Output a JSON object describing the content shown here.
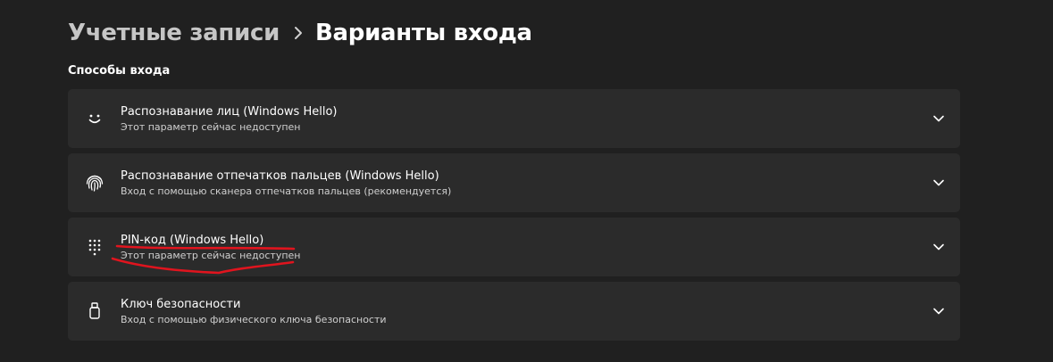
{
  "breadcrumb": {
    "parent": "Учетные записи",
    "current": "Варианты входа"
  },
  "section_title": "Способы входа",
  "options": [
    {
      "icon": "face-icon",
      "title": "Распознавание лиц (Windows Hello)",
      "subtitle": "Этот параметр сейчас недоступен"
    },
    {
      "icon": "fingerprint-icon",
      "title": "Распознавание отпечатков пальцев (Windows Hello)",
      "subtitle": "Вход с помощью сканера отпечатков пальцев (рекомендуется)"
    },
    {
      "icon": "pin-keypad-icon",
      "title": "PIN-код (Windows Hello)",
      "subtitle": "Этот параметр сейчас недоступен"
    },
    {
      "icon": "security-key-icon",
      "title": "Ключ безопасности",
      "subtitle": "Вход с помощью физического ключа безопасности"
    }
  ],
  "colors": {
    "background": "#202020",
    "card": "#2b2b2b",
    "annotation": "#e0141e"
  }
}
